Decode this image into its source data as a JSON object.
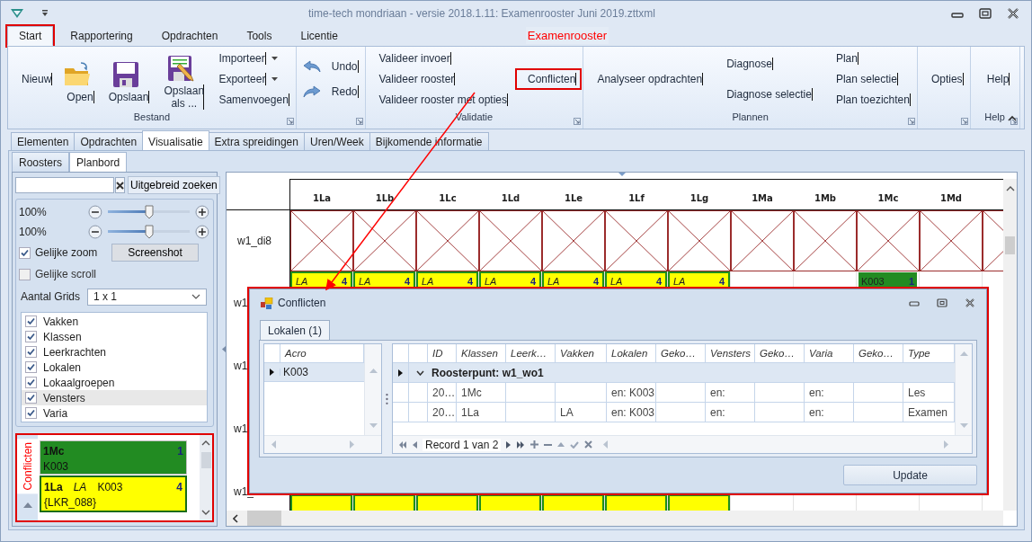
{
  "window": {
    "title": "time-tech mondriaan - versie 2018.1.11: Examenrooster Juni 2019.zttxml"
  },
  "ribbon_tabs": [
    {
      "label": "Start",
      "selected": true,
      "annotated": true
    },
    {
      "label": "Rapportering",
      "selected": false,
      "annotated": false
    },
    {
      "label": "Opdrachten",
      "selected": false,
      "annotated": false
    },
    {
      "label": "Tools",
      "selected": false,
      "annotated": false
    },
    {
      "label": "Licentie",
      "selected": false,
      "annotated": false
    }
  ],
  "context_tab": "Examenrooster",
  "ribbon_groups": [
    {
      "label": "Bestand",
      "launcher": true,
      "columns": [
        [
          {
            "label": "Nieuw",
            "kind": "text"
          }
        ],
        [
          {
            "label": "Open",
            "kind": "folder"
          }
        ],
        [
          {
            "label": "Opslaan",
            "kind": "disk"
          }
        ],
        [
          {
            "label": "Opslaan als ...",
            "kind": "saveas"
          }
        ],
        [
          {
            "label": "Importeer",
            "kind": "menu"
          },
          {
            "label": "Exporteer",
            "kind": "menu"
          },
          {
            "label": "Samenvoegen",
            "kind": "text"
          }
        ]
      ]
    },
    {
      "launcher": true,
      "columns": [
        [
          {
            "label": "Undo",
            "kind": "undo"
          },
          {
            "label": "Redo",
            "kind": "redo"
          }
        ]
      ]
    },
    {
      "label": "Validatie",
      "launcher": true,
      "columns": [
        [
          {
            "label": "Valideer invoer",
            "kind": "text"
          },
          {
            "label": "Valideer rooster",
            "kind": "text"
          },
          {
            "label": "Valideer rooster met opties",
            "kind": "text"
          }
        ],
        [
          {
            "label": "Conflicten",
            "kind": "text",
            "annotated": true
          }
        ]
      ]
    },
    {
      "label": "Plannen",
      "launcher": true,
      "columns": [
        [
          {
            "label": "Analyseer opdrachten",
            "kind": "text"
          }
        ],
        [
          {
            "label": "Diagnose",
            "kind": "text"
          },
          {
            "label": "Diagnose selectie",
            "kind": "text"
          }
        ],
        [
          {
            "label": "Plan",
            "kind": "text"
          },
          {
            "label": "Plan selectie",
            "kind": "text"
          },
          {
            "label": "Plan toezichten",
            "kind": "text"
          }
        ]
      ]
    },
    {
      "launcher": true,
      "columns": [
        [
          {
            "label": "Opties",
            "kind": "text"
          }
        ]
      ]
    },
    {
      "label": "Help",
      "launcher": true,
      "columns": [
        [
          {
            "label": "Help",
            "kind": "text"
          }
        ]
      ]
    }
  ],
  "doc_tabs": [
    {
      "label": "Elementen",
      "selected": false
    },
    {
      "label": "Opdrachten",
      "selected": false
    },
    {
      "label": "Visualisatie",
      "selected": true
    },
    {
      "label": "Extra spreidingen",
      "selected": false
    },
    {
      "label": "Uren/Week",
      "selected": false
    },
    {
      "label": "Bijkomende informatie",
      "selected": false
    }
  ],
  "view_tabs": [
    {
      "label": "Roosters",
      "selected": false
    },
    {
      "label": "Planbord",
      "selected": true
    }
  ],
  "sidebar": {
    "advanced_search": "Uitgebreid zoeken",
    "zoom_sliders": [
      {
        "reading": "100%",
        "level": 0.5
      },
      {
        "reading": "100%",
        "level": 0.5
      }
    ],
    "options": [
      {
        "label": "Gelijke zoom",
        "checked": true
      },
      {
        "label": "Gelijke scroll",
        "checked": false
      }
    ],
    "screenshot_button": "Screenshot",
    "grids": {
      "label": "Aantal Grids",
      "value": "1 x 1"
    },
    "layers": [
      {
        "label": "Vakken",
        "checked": true,
        "selected": false
      },
      {
        "label": "Klassen",
        "checked": true,
        "selected": false
      },
      {
        "label": "Leerkrachten",
        "checked": true,
        "selected": false
      },
      {
        "label": "Lokalen",
        "checked": true,
        "selected": false
      },
      {
        "label": "Lokaalgroepen",
        "checked": true,
        "selected": false
      },
      {
        "label": "Vensters",
        "checked": true,
        "selected": true
      },
      {
        "label": "Varia",
        "checked": true,
        "selected": false
      }
    ],
    "conflicts": {
      "tab": "Conflicten",
      "annotated": true,
      "cards": [
        {
          "kind": "lesson",
          "class": "1Mc",
          "room": "K003",
          "count": "1",
          "color": "#228b22",
          "selected": false
        },
        {
          "kind": "exam",
          "class": "1La",
          "subject": "LA",
          "room": "K003",
          "count": "4",
          "note": "{LKR_088}",
          "color": "#ffff00",
          "selected": true
        }
      ]
    }
  },
  "planbord": {
    "columns": [
      "1La",
      "1Lb",
      "1Lc",
      "1Ld",
      "1Le",
      "1Lf",
      "1Lg",
      "1Ma",
      "1Mb",
      "1Mc",
      "1Md"
    ],
    "rows": [
      {
        "label": "w1_di8",
        "cells": [
          {
            "blocked": true
          },
          {
            "blocked": true
          },
          {
            "blocked": true
          },
          {
            "blocked": true
          },
          {
            "blocked": true
          },
          {
            "blocked": true
          },
          {
            "blocked": true
          },
          {
            "blocked": true
          },
          {
            "blocked": true
          },
          {
            "blocked": true
          },
          {
            "blocked": true
          },
          {
            "blocked": true
          }
        ]
      },
      {
        "label": "w1",
        "cells": [
          {
            "kind": "subject",
            "text": "LA",
            "count": "4",
            "color": "#ffff00"
          },
          {
            "kind": "subject",
            "text": "LA",
            "count": "4",
            "color": "#ffff00"
          },
          {
            "kind": "subject",
            "text": "LA",
            "count": "4",
            "color": "#ffff00"
          },
          {
            "kind": "subject",
            "text": "LA",
            "count": "4",
            "color": "#ffff00"
          },
          {
            "kind": "subject",
            "text": "LA",
            "count": "4",
            "color": "#ffff00"
          },
          {
            "kind": "subject",
            "text": "LA",
            "count": "4",
            "color": "#ffff00"
          },
          {
            "kind": "subject",
            "text": "LA",
            "count": "4",
            "color": "#ffff00"
          },
          null,
          null,
          {
            "kind": "room",
            "text": "K003",
            "count": "1",
            "color": "#228b22"
          }
        ]
      },
      {
        "label": "w1"
      },
      {
        "label": "w1"
      },
      {
        "label": "w1_",
        "cells": [
          {
            "kind": "subject",
            "color": "#ffff00"
          },
          {
            "kind": "subject",
            "color": "#ffff00"
          },
          {
            "kind": "subject",
            "color": "#ffff00"
          },
          {
            "kind": "subject",
            "color": "#ffff00"
          },
          {
            "kind": "subject",
            "color": "#ffff00"
          },
          {
            "kind": "subject",
            "color": "#ffff00"
          },
          {
            "kind": "subject",
            "color": "#ffff00"
          }
        ]
      }
    ]
  },
  "dialog": {
    "title": "Conflicten",
    "annotated": true,
    "tabs": [
      {
        "label": "Lokalen (1)",
        "selected": true
      }
    ],
    "rooms": {
      "columns": [
        "Acro"
      ],
      "rows": [
        {
          "acro": "K003",
          "selected": true
        }
      ]
    },
    "records": {
      "columns": [
        "ID",
        "Klassen",
        "Leerk…",
        "Vakken",
        "Lokalen",
        "Geko…",
        "Vensters",
        "Geko…",
        "Varia",
        "Geko…",
        "Type"
      ],
      "group": {
        "label": "Roosterpunt: w1_wo1",
        "expanded": true
      },
      "rows": [
        [
          "20…",
          "1Mc",
          null,
          null,
          "en: K003",
          null,
          "en:",
          null,
          "en:",
          null,
          "Les"
        ],
        [
          "20…",
          "1La",
          null,
          "LA",
          "en: K003",
          null,
          "en:",
          null,
          "en:",
          null,
          "Examen"
        ]
      ],
      "navigator": "Record 1 van 2"
    },
    "update_button": "Update"
  }
}
